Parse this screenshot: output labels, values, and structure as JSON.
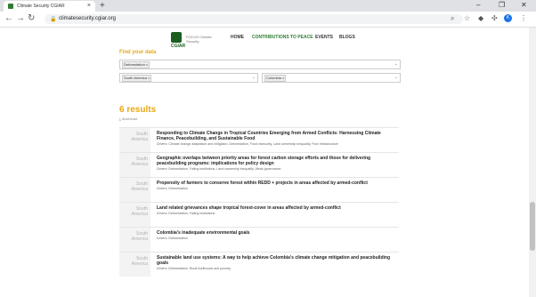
{
  "browser": {
    "tab_title": "Climate Security CGIAR",
    "url": "climatesecurity.cgiar.org",
    "profile_initial": "K"
  },
  "site": {
    "logo_text": "CGIAR",
    "logo_focus": "FOCUS Climate Security",
    "nav": [
      "HOME",
      "CONTRIBUTIONS TO PEACE",
      "EVENTS",
      "BLOGS"
    ]
  },
  "filters": {
    "heading": "Find your data",
    "driver_chip": "Deforestation",
    "region_chip": "South America",
    "country_chip": "Colombia"
  },
  "results": {
    "count_label": "6 results",
    "download_label": "download",
    "items": [
      {
        "region": "South America",
        "title": "Responding to Climate Change in Tropical Countries Emerging from Armed Conflicts: Harnessing Climate Finance, Peacebuilding, and Sustainable Food",
        "drivers_prefix": "Drivers:",
        "drivers": "Climate change adaptation and mitigation, Deforestation, Food insecurity, Land ownership inequality, Poor infrastructure"
      },
      {
        "region": "South America",
        "title": "Geographic overlaps between priority areas for forest carbon storage efforts and those for delivering peacebuilding programs: implications for policy design",
        "drivers_prefix": "Drivers:",
        "drivers": "Deforestation, Failing institutions, Land ownership inequality, Weak governance"
      },
      {
        "region": "South America",
        "title": "Propensity of farmers to conserve forest within REDD + projects in areas affected by armed-conflict",
        "drivers_prefix": "Drivers:",
        "drivers": "Deforestation"
      },
      {
        "region": "South America",
        "title": "Land related grievances shape tropical forest-cover in areas affected by armed-conflict",
        "drivers_prefix": "Drivers:",
        "drivers": "Deforestation, Failing institutions"
      },
      {
        "region": "South America",
        "title": "Colombia's inadequate environmental goals",
        "drivers_prefix": "Drivers:",
        "drivers": "Deforestation"
      },
      {
        "region": "South America",
        "title": "Sustainable land use systems: A way to help achieve Colombia's climate change mitigation and peacebuilding goals",
        "drivers_prefix": "Drivers:",
        "drivers": "Deforestation, Rural livelihoods and poverty"
      }
    ]
  }
}
